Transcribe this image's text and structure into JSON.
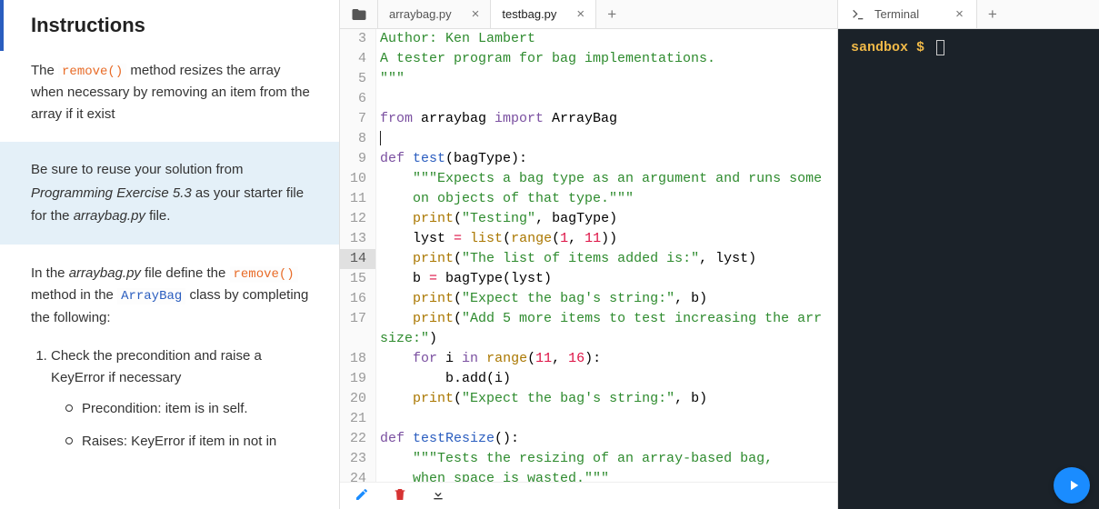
{
  "instructions": {
    "title": "Instructions",
    "p1_pre": "The ",
    "p1_code": "remove()",
    "p1_post": " method resizes the array when necessary by removing an item from the array if it exist",
    "callout_pre": "Be sure to reuse your solution from ",
    "callout_em": "Programming Exercise 5.3",
    "callout_mid": " as your starter file for the ",
    "callout_file": "arraybag.py",
    "callout_post": " file.",
    "p2_a": "In the ",
    "p2_file": "arraybag.py",
    "p2_b": " file define the ",
    "p2_code": "remove()",
    "p2_c": " method in the ",
    "p2_class": "ArrayBag",
    "p2_d": " class by completing the following:",
    "li1": "Check the precondition and raise a KeyError if necessary",
    "sub1": "Precondition: item is in self.",
    "sub2": "Raises: KeyError if item in not in"
  },
  "editor": {
    "tabs": [
      "arraybag.py",
      "testbag.py"
    ],
    "active_tab": 1,
    "highlight_line": 14,
    "lines": [
      {
        "n": 3,
        "tokens": [
          {
            "c": "tok-comment",
            "t": "Author: Ken Lambert"
          }
        ]
      },
      {
        "n": 4,
        "tokens": [
          {
            "c": "tok-comment",
            "t": "A tester program for bag implementations."
          }
        ]
      },
      {
        "n": 5,
        "tokens": [
          {
            "c": "tok-string",
            "t": "\"\"\""
          }
        ]
      },
      {
        "n": 6,
        "tokens": [
          {
            "c": "",
            "t": ""
          }
        ]
      },
      {
        "n": 7,
        "tokens": [
          {
            "c": "tok-keyword",
            "t": "from"
          },
          {
            "c": "",
            "t": " arraybag "
          },
          {
            "c": "tok-keyword",
            "t": "import"
          },
          {
            "c": "",
            "t": " ArrayBag"
          }
        ]
      },
      {
        "n": 8,
        "tokens": [
          {
            "c": "",
            "t": ""
          }
        ],
        "cursor": true
      },
      {
        "n": 9,
        "tokens": [
          {
            "c": "tok-def",
            "t": "def"
          },
          {
            "c": "",
            "t": " "
          },
          {
            "c": "tok-func",
            "t": "test"
          },
          {
            "c": "",
            "t": "(bagType):"
          }
        ]
      },
      {
        "n": 10,
        "tokens": [
          {
            "c": "",
            "t": "    "
          },
          {
            "c": "tok-string",
            "t": "\"\"\"Expects a bag type as an argument and runs some"
          }
        ]
      },
      {
        "n": 11,
        "tokens": [
          {
            "c": "tok-string",
            "t": "    on objects of that type.\"\"\""
          }
        ]
      },
      {
        "n": 12,
        "tokens": [
          {
            "c": "",
            "t": "    "
          },
          {
            "c": "tok-builtin",
            "t": "print"
          },
          {
            "c": "",
            "t": "("
          },
          {
            "c": "tok-string",
            "t": "\"Testing\""
          },
          {
            "c": "",
            "t": ", bagType)"
          }
        ]
      },
      {
        "n": 13,
        "tokens": [
          {
            "c": "",
            "t": "    lyst "
          },
          {
            "c": "tok-op",
            "t": "="
          },
          {
            "c": "",
            "t": " "
          },
          {
            "c": "tok-builtin",
            "t": "list"
          },
          {
            "c": "",
            "t": "("
          },
          {
            "c": "tok-builtin",
            "t": "range"
          },
          {
            "c": "",
            "t": "("
          },
          {
            "c": "tok-number",
            "t": "1"
          },
          {
            "c": "",
            "t": ", "
          },
          {
            "c": "tok-number",
            "t": "11"
          },
          {
            "c": "",
            "t": "))"
          }
        ]
      },
      {
        "n": 14,
        "tokens": [
          {
            "c": "",
            "t": "    "
          },
          {
            "c": "tok-builtin",
            "t": "print"
          },
          {
            "c": "",
            "t": "("
          },
          {
            "c": "tok-string",
            "t": "\"The list of items added is:\""
          },
          {
            "c": "",
            "t": ", lyst)"
          }
        ]
      },
      {
        "n": 15,
        "tokens": [
          {
            "c": "",
            "t": "    b "
          },
          {
            "c": "tok-op",
            "t": "="
          },
          {
            "c": "",
            "t": " bagType(lyst)"
          }
        ]
      },
      {
        "n": 16,
        "tokens": [
          {
            "c": "",
            "t": "    "
          },
          {
            "c": "tok-builtin",
            "t": "print"
          },
          {
            "c": "",
            "t": "("
          },
          {
            "c": "tok-string",
            "t": "\"Expect the bag's string:\""
          },
          {
            "c": "",
            "t": ", b)"
          }
        ]
      },
      {
        "n": 17,
        "tokens": [
          {
            "c": "",
            "t": "    "
          },
          {
            "c": "tok-builtin",
            "t": "print"
          },
          {
            "c": "",
            "t": "("
          },
          {
            "c": "tok-string",
            "t": "\"Add 5 more items to test increasing the arr"
          }
        ]
      },
      {
        "n": "",
        "wrap": true,
        "tokens": [
          {
            "c": "tok-string",
            "t": "size:\""
          },
          {
            "c": "",
            "t": ")"
          }
        ]
      },
      {
        "n": 18,
        "tokens": [
          {
            "c": "",
            "t": "    "
          },
          {
            "c": "tok-keyword",
            "t": "for"
          },
          {
            "c": "",
            "t": " i "
          },
          {
            "c": "tok-keyword",
            "t": "in"
          },
          {
            "c": "",
            "t": " "
          },
          {
            "c": "tok-builtin",
            "t": "range"
          },
          {
            "c": "",
            "t": "("
          },
          {
            "c": "tok-number",
            "t": "11"
          },
          {
            "c": "",
            "t": ", "
          },
          {
            "c": "tok-number",
            "t": "16"
          },
          {
            "c": "",
            "t": "):"
          }
        ]
      },
      {
        "n": 19,
        "tokens": [
          {
            "c": "",
            "t": "        b.add(i)"
          }
        ]
      },
      {
        "n": 20,
        "tokens": [
          {
            "c": "",
            "t": "    "
          },
          {
            "c": "tok-builtin",
            "t": "print"
          },
          {
            "c": "",
            "t": "("
          },
          {
            "c": "tok-string",
            "t": "\"Expect the bag's string:\""
          },
          {
            "c": "",
            "t": ", b)"
          }
        ]
      },
      {
        "n": 21,
        "tokens": [
          {
            "c": "",
            "t": ""
          }
        ]
      },
      {
        "n": 22,
        "tokens": [
          {
            "c": "tok-def",
            "t": "def"
          },
          {
            "c": "",
            "t": " "
          },
          {
            "c": "tok-func",
            "t": "testResize"
          },
          {
            "c": "",
            "t": "():"
          }
        ]
      },
      {
        "n": 23,
        "tokens": [
          {
            "c": "",
            "t": "    "
          },
          {
            "c": "tok-string",
            "t": "\"\"\"Tests the resizing of an array-based bag,"
          }
        ]
      },
      {
        "n": 24,
        "tokens": [
          {
            "c": "tok-string",
            "t": "    when space is wasted.\"\"\""
          }
        ]
      }
    ]
  },
  "terminal": {
    "tab_label": "Terminal",
    "prompt_text": "sandbox $"
  }
}
